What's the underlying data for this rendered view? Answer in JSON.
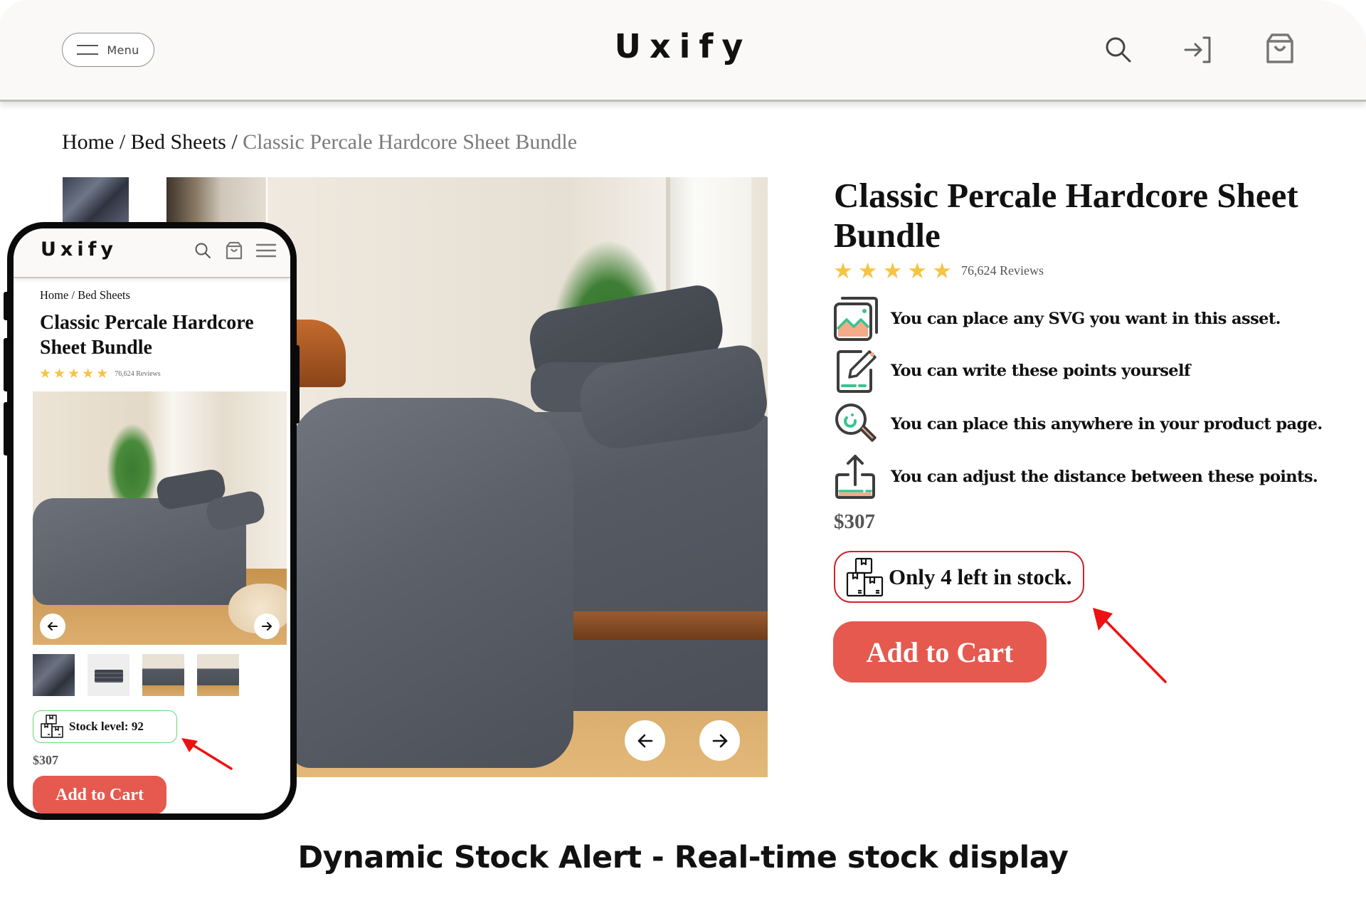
{
  "header": {
    "menu_label": "Menu",
    "logo": "Uxify",
    "icons": [
      "search-icon",
      "login-icon",
      "shopping-bag-icon"
    ]
  },
  "breadcrumb": {
    "items": [
      "Home",
      "Bed Sheets"
    ],
    "separator": " / ",
    "current": "Classic Percale Hardcore Sheet Bundle"
  },
  "product": {
    "title": "Classic Percale Hardcore Sheet Bundle",
    "rating_stars": 5,
    "reviews": "76,624 Reviews",
    "features": [
      {
        "icon": "image-gallery-icon",
        "text": "You can place any SVG you want in this asset."
      },
      {
        "icon": "edit-document-icon",
        "text": "You can write these points yourself"
      },
      {
        "icon": "search-magnifier-icon",
        "text": "You can place this anywhere in your product page."
      },
      {
        "icon": "upload-share-icon",
        "text": "You can adjust the distance between these points."
      }
    ],
    "price": "$307",
    "stock_alert": "Only 4 left in stock.",
    "stock_alert_color": "#d0242a",
    "add_to_cart": "Add to Cart",
    "accent_color": "#e5594f"
  },
  "gallery": {
    "prev_icon": "arrow-left-icon",
    "next_icon": "arrow-right-icon"
  },
  "mobile": {
    "logo": "Uxify",
    "breadcrumb": "Home / Bed Sheets",
    "title": "Classic Percale Hardcore Sheet Bundle",
    "rating_stars": 5,
    "reviews": "76,624 Reviews",
    "thumbnails": [
      "sheet-fabric-closeup",
      "folded-sheet-stack",
      "bedroom-scene-1",
      "bedroom-scene-2"
    ],
    "stock_level": "Stock level: 92",
    "stock_level_color": "#66d96f",
    "price": "$307",
    "add_to_cart": "Add to Cart"
  },
  "caption": "Dynamic Stock Alert - Real-time stock display"
}
